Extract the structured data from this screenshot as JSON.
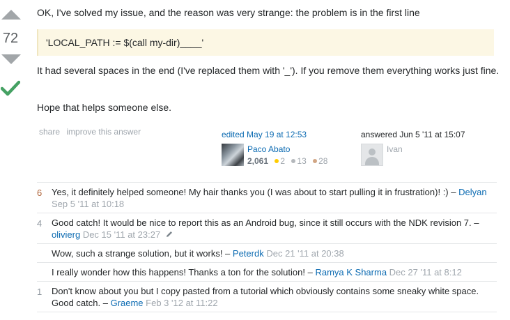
{
  "vote": {
    "count": "72",
    "accepted": true
  },
  "post": {
    "paragraph1": "OK, I've solved my issue, and the reason was very strange: the problem is in the first line",
    "code": "'LOCAL_PATH := $(call my-dir)____'",
    "paragraph2": "It had several spaces in the end (I've replaced them with '_'). If you remove them everything works just fine.",
    "paragraph3": "Hope that helps someone else."
  },
  "menu": {
    "share": "share",
    "improve": "improve this answer"
  },
  "edited": {
    "action": "edited May 19 at 12:53",
    "user": "Paco Abato",
    "reputation": "2,061",
    "gold": "2",
    "silver": "13",
    "bronze": "28"
  },
  "answered": {
    "action": "answered Jun 5 '11 at 15:07",
    "user": "Ivan"
  },
  "comments": [
    {
      "score": "6",
      "text": "Yes, it definitely helped someone! My hair thanks you (I was about to start pulling it in frustration)! :) –",
      "user": "Delyan",
      "date": "Sep 5 '11 at 10:18"
    },
    {
      "score": "4",
      "text": "Good catch! It would be nice to report this as an Android bug, since it still occurs with the NDK revision 7. –",
      "user": "olivierg",
      "date": "Dec 15 '11 at 23:27"
    },
    {
      "score": "",
      "text": "Wow, such a strange solution, but it works! –",
      "user": "Peterdk",
      "date": "Dec 21 '11 at 20:38"
    },
    {
      "score": "",
      "text": "I really wonder how this happens! Thanks a ton for the solution! –",
      "user": "Ramya K Sharma",
      "date": "Dec 27 '11 at 8:12"
    },
    {
      "score": "1",
      "text": "Don't know about you but I copy pasted from a tutorial which obviously contains some sneaky white space. Good catch. –",
      "user": "Graeme",
      "date": "Feb 3 '12 at 11:22"
    }
  ],
  "colors": {
    "link": "#0c6bb2",
    "accepted": "#45a163",
    "code_background": "#fcf7e4",
    "comment_score_hot": "#b0663c"
  }
}
